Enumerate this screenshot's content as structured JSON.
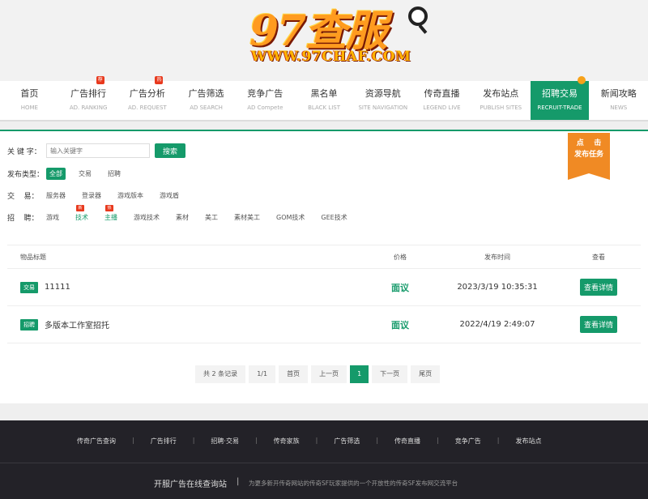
{
  "logo": {
    "main": "97查服",
    "url": "WWW.97CHAF.COM"
  },
  "nav": [
    {
      "cn": "首页",
      "en": "HOME",
      "badge": ""
    },
    {
      "cn": "广告排行",
      "en": "AD. RANKING",
      "badge": "荐"
    },
    {
      "cn": "广告分析",
      "en": "AD. REQUEST",
      "badge": "热"
    },
    {
      "cn": "广告筛选",
      "en": "AD SEARCH",
      "badge": ""
    },
    {
      "cn": "竞争广告",
      "en": "AD Compete",
      "badge": ""
    },
    {
      "cn": "黑名单",
      "en": "BLACK LIST",
      "badge": ""
    },
    {
      "cn": "资源导航",
      "en": "SITE NAVIGATION",
      "badge": ""
    },
    {
      "cn": "传奇直播",
      "en": "LEGEND LIVE",
      "badge": ""
    },
    {
      "cn": "发布站点",
      "en": "PUBLISH SITES",
      "badge": ""
    },
    {
      "cn": "招聘交易",
      "en": "RECRUIT-TRADE",
      "badge": ""
    },
    {
      "cn": "新闻攻略",
      "en": "NEWS",
      "badge": ""
    }
  ],
  "filters": {
    "keyword_label": "关 键 字：",
    "keyword_placeholder": "输入关键字",
    "search_label": "搜索",
    "type_label": "发布类型：",
    "types": [
      "全部",
      "交易",
      "招聘"
    ],
    "trade_label": "交    易：",
    "trades": [
      "服务器",
      "登录器",
      "游戏版本",
      "游戏盾"
    ],
    "recruit_label": "招    聘：",
    "recruits": [
      "游戏",
      "技术",
      "主播",
      "游戏技术",
      "素材",
      "美工",
      "素材美工",
      "GOM技术",
      "GEE技术"
    ],
    "recruit_badges": [
      "",
      "新",
      "热",
      "",
      "",
      "",
      "",
      "",
      ""
    ]
  },
  "publish_tag": {
    "line1": "点    击",
    "line2": "发布任务"
  },
  "table": {
    "headers": {
      "title": "物品标题",
      "price": "价格",
      "time": "发布时间",
      "view": "查看"
    },
    "rows": [
      {
        "tag": "交易",
        "title": "11111",
        "price": "面议",
        "time": "2023/3/19 10:35:31",
        "button": "查看详情"
      },
      {
        "tag": "招聘",
        "title": "多版本工作室招托",
        "price": "面议",
        "time": "2022/4/19 2:49:07",
        "button": "查看详情"
      }
    ]
  },
  "pager": {
    "total": "共 2 条记录",
    "pages": "1/1",
    "first": "首页",
    "prev": "上一页",
    "current": "1",
    "next": "下一页",
    "last": "尾页"
  },
  "footer": {
    "links": [
      "传奇广告查询",
      "广告排行",
      "招聘·交易",
      "传奇家族",
      "广告筛选",
      "传奇直播",
      "竞争广告",
      "发布站点"
    ],
    "brand": "开服广告在线查询站",
    "desc": "为更多新开传奇网站的传奇SF玩家提供的一个开放性的传奇SF发布网交流平台"
  },
  "colors": {
    "accent": "#159a6a",
    "badge": "#e8391d",
    "publish": "#f08a24",
    "footer_bg": "#232228"
  }
}
